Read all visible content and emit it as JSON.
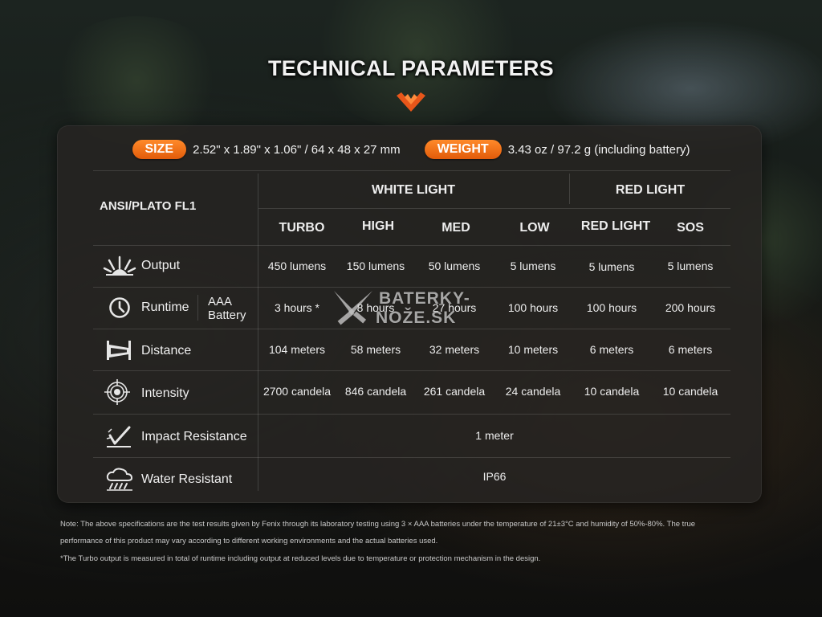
{
  "title": "TECHNICAL PARAMETERS",
  "colors": {
    "accent": "#f06a12",
    "panel": "#262422"
  },
  "size": {
    "label": "SIZE",
    "value": "2.52\" x 1.89\" x 1.06\" / 64 x 48 x 27 mm"
  },
  "weight": {
    "label": "WEIGHT",
    "value": "3.43 oz / 97.2 g (including battery)"
  },
  "table": {
    "corner": "ANSI/PLATO FL1",
    "groups": [
      "WHITE LIGHT",
      "RED LIGHT"
    ],
    "modes": [
      "TURBO",
      "HIGH",
      "MED",
      "LOW",
      "RED LIGHT",
      "SOS"
    ],
    "rows": {
      "output": {
        "label": "Output",
        "icon": "burst-icon",
        "values": [
          "450 lumens",
          "150 lumens",
          "50 lumens",
          "5 lumens",
          "5 lumens",
          "5 lumens"
        ]
      },
      "runtime": {
        "label": "Runtime",
        "icon": "clock-icon",
        "sublabel_1": "AAA",
        "sublabel_2": "Battery",
        "values": [
          "3 hours *",
          "8 hours",
          "27 hours",
          "100  hours",
          "100  hours",
          "200 hours"
        ]
      },
      "distance": {
        "label": "Distance",
        "icon": "beam-distance-icon",
        "values": [
          "104 meters",
          "58 meters",
          "32 meters",
          "10 meters",
          "6 meters",
          "6 meters"
        ]
      },
      "intensity": {
        "label": "Intensity",
        "icon": "target-icon",
        "values": [
          "2700 candela",
          "846 candela",
          "261 candela",
          "24 candela",
          "10 candela",
          "10 candela"
        ]
      },
      "impact": {
        "label": "Impact Resistance",
        "icon": "impact-icon",
        "value": "1 meter"
      },
      "water": {
        "label": "Water Resistant",
        "icon": "rain-cloud-icon",
        "value": "IP66"
      }
    }
  },
  "watermark": {
    "line1": "BATERKY-",
    "line2": "NOŽE.SK"
  },
  "notes": {
    "line1": "Note: The above specifications are the test results given by Fenix through its laboratory testing using 3 × AAA batteries under the temperature of 21±3°C and humidity of 50%-80%. The true",
    "line2": "performance of this product may vary according to different working environments and the actual batteries used.",
    "line3": "*The Turbo output is measured in total of runtime including output at reduced levels due to temperature or protection mechanism in the design."
  }
}
